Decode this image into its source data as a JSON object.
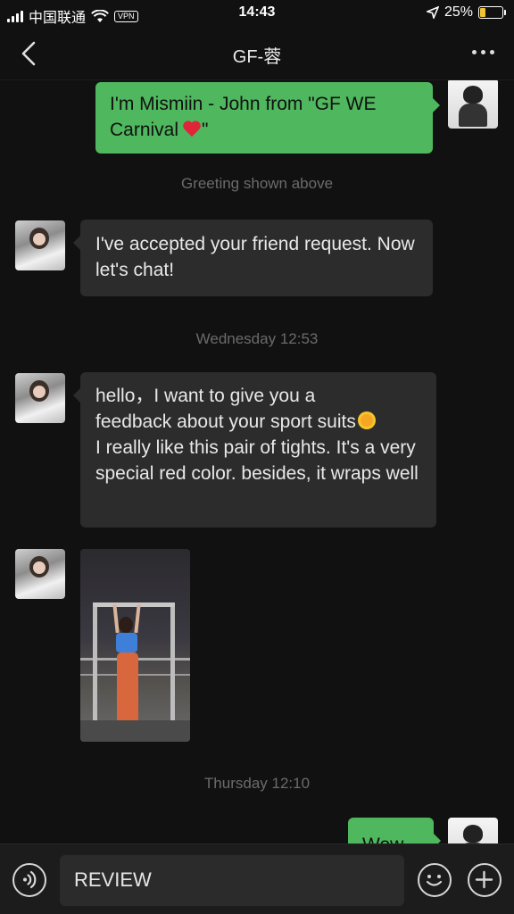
{
  "status_bar": {
    "carrier": "中国联通",
    "vpn": "VPN",
    "time": "14:43",
    "battery": "25%",
    "battery_level": 0.25
  },
  "nav": {
    "title": "GF-蓉"
  },
  "messages": [
    {
      "type": "text",
      "side": "me",
      "text": "I'm Mismiin - John from \"GF WE Carnival",
      "after_emoji": "\""
    },
    {
      "type": "system",
      "text": "Greeting shown above"
    },
    {
      "type": "text",
      "side": "her",
      "text": "I've accepted your friend request. Now let's chat!"
    },
    {
      "type": "system",
      "text": "Wednesday 12:53"
    },
    {
      "type": "text",
      "side": "her",
      "line1": "hello，I want to give you a",
      "line2": "feedback about your sport suits",
      "line3": "I really like this pair of tights. It's a very special red color. besides, it wraps well"
    },
    {
      "type": "image",
      "side": "her"
    },
    {
      "type": "system",
      "text": "Thursday 12:10"
    },
    {
      "type": "text",
      "side": "me",
      "text": "Wow"
    }
  ],
  "input": {
    "value": "REVIEW"
  },
  "colors": {
    "bubble_out": "#4fb75e",
    "bubble_in": "#2c2c2c",
    "background": "#111111"
  }
}
